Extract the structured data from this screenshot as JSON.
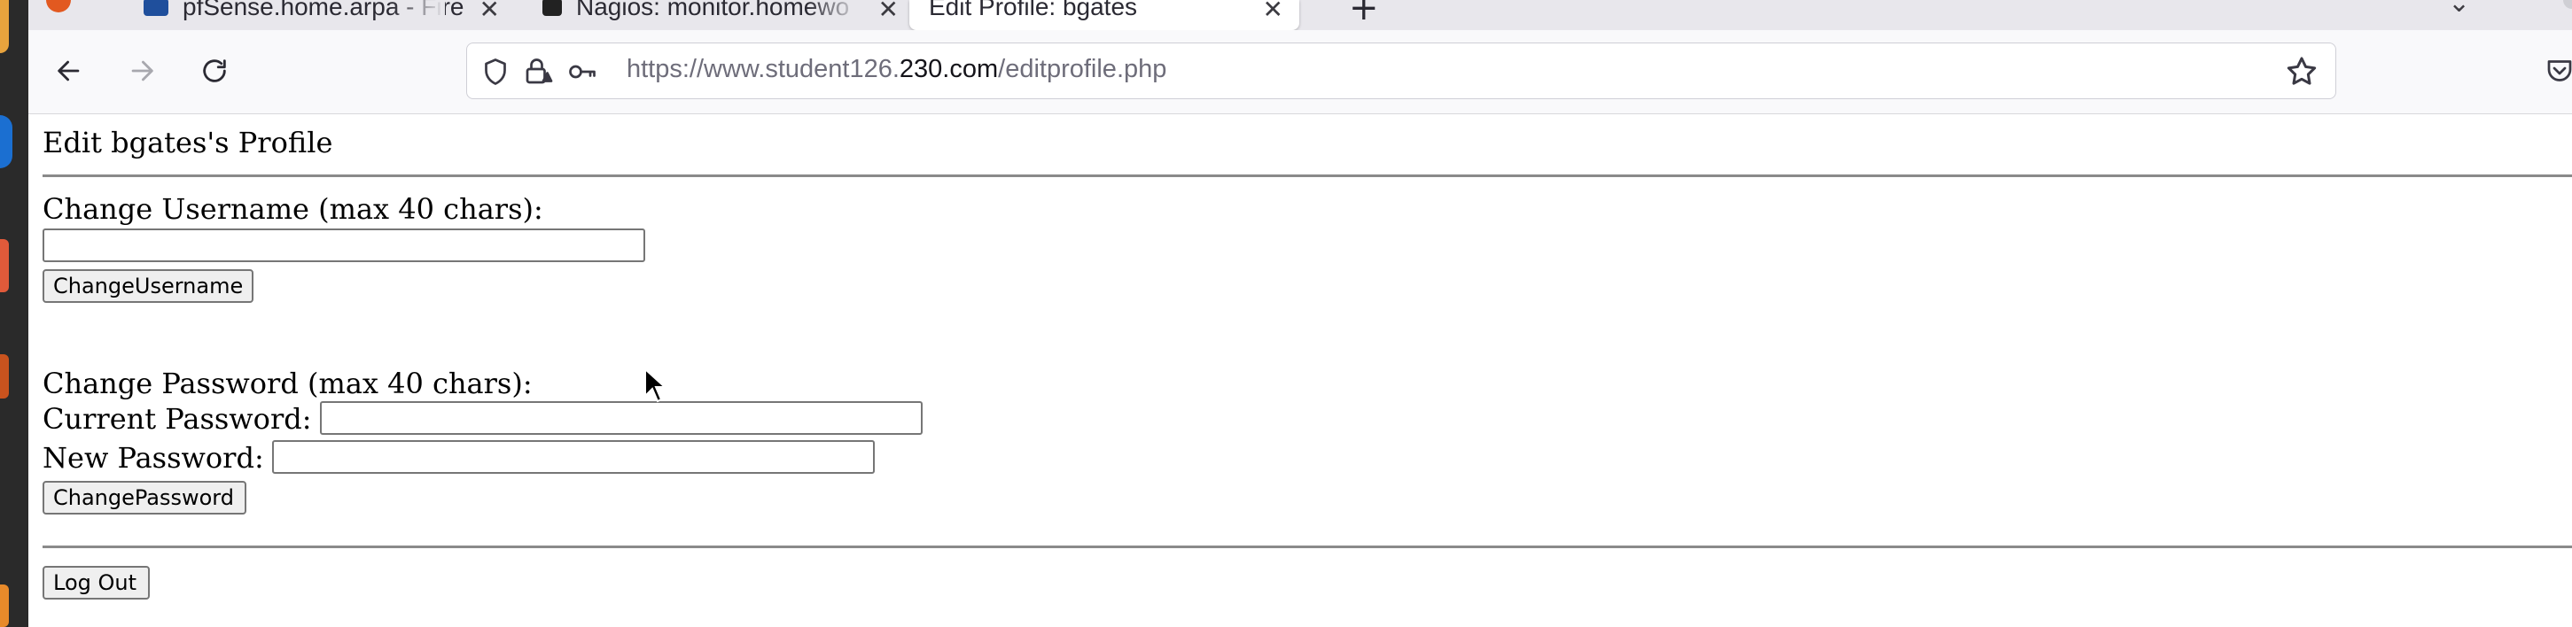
{
  "browser": {
    "tabs": [
      {
        "title": "pfSense.home.arpa - Fire"
      },
      {
        "title": "Nagios: monitor.homewo"
      },
      {
        "title": "Edit Profile: bgates",
        "active": true
      }
    ],
    "new_tab_label": "+",
    "url": {
      "prefix": "https://www.student126.",
      "domain": "230.com",
      "path": "/editprofile.php"
    }
  },
  "page": {
    "heading": "Edit bgates's Profile",
    "username_section": {
      "label": "Change Username (max 40 chars):",
      "button": "ChangeUsername"
    },
    "password_section": {
      "label": "Change Password (max 40 chars):",
      "current_label": "Current Password:",
      "new_label": "New Password:",
      "button": "ChangePassword"
    },
    "logout_button": "Log Out"
  }
}
